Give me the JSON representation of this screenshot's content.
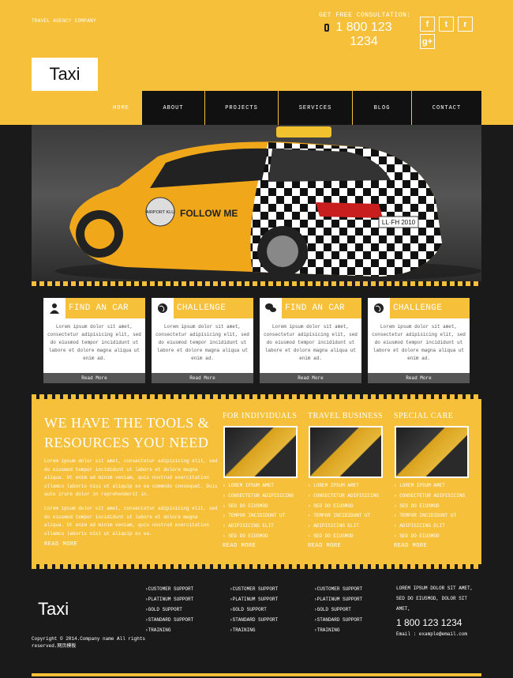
{
  "header": {
    "tagline": "TRAVEL AGENCY COMPANY",
    "consult_label": "GET FREE CONSULTATION:",
    "phone": "1 800 123 1234",
    "social": [
      {
        "icon": "facebook-icon",
        "glyph": "f"
      },
      {
        "icon": "twitter-icon",
        "glyph": "t"
      },
      {
        "icon": "rss-icon",
        "glyph": "r"
      },
      {
        "icon": "googleplus-icon",
        "glyph": "g+"
      }
    ]
  },
  "logo": "Taxi",
  "nav": [
    {
      "label": "HOME",
      "active": true
    },
    {
      "label": "ABOUT",
      "active": false
    },
    {
      "label": "PROJECTS",
      "active": false
    },
    {
      "label": "SERVICES",
      "active": false
    },
    {
      "label": "BLOG",
      "active": false
    },
    {
      "label": "CONTACT",
      "active": false
    }
  ],
  "hero": {
    "door_badge": "AIRPORT KLU",
    "door_text": "FOLLOW ME",
    "plate": "LL·FH 2010"
  },
  "cards": [
    {
      "title": "FIND AN CAR",
      "icon": "user-icon",
      "text": "Lorem ipsum dolor sit amet, consectetur adipisicing elit, sed do eiusmod tempor incididunt ut labore et dolore magna aliqua ut enim ad.",
      "button": "Read More"
    },
    {
      "title": "CHALLENGE",
      "icon": "globe-icon",
      "text": "Lorem ipsum dolor sit amet, consectetur adipisicing elit, sed do eiusmod tempor incididunt ut labore et dolore magna aliqua ut enim ad.",
      "button": "Read More"
    },
    {
      "title": "FIND AN CAR",
      "icon": "chat-icon",
      "text": "Lorem ipsum dolor sit amet, consectetur adipisicing elit, sed do eiusmod tempor incididunt ut labore et dolore magna aliqua ut enim ad.",
      "button": "Read More"
    },
    {
      "title": "CHALLENGE",
      "icon": "globe-icon",
      "text": "Lorem ipsum dolor sit amet, consectetur adipisicing elit, sed do eiusmod tempor incididunt ut labore et dolore magna aliqua ut enim ad.",
      "button": "Read More"
    }
  ],
  "mid": {
    "title": "WE HAVE THE TOOLS & RESOURCES YOU NEED",
    "para1": "Lorem ipsum dolor sit amet, consectetur adipisicing elit, sed do eiusmod tempor incididunt ut labore et dolore magna aliqua. Ut enim ad minim veniam, quis nostrud exercitation ullamco laboris nisi ut aliquip ex ea commodo consequat. Duis aute irure dolor in reprehenderit in.",
    "para2": "Lorem ipsum dolor sit amet, consectetur adipisicing elit, sed do eiusmod tempor incididunt ut labore et dolore magna aliqua. Ut enim ad minim veniam, quis nostrud exercitation ullamco laboris nisi ut aliquip ex ea.",
    "read_more": "READ MORE",
    "columns": [
      {
        "title": "FOR INDIVIDUALS",
        "items": [
          "LOREM IPSUM AMET",
          "CONSECTETUR ADIPISICING",
          "SED DO EIUSMOD",
          "TEMPOR INCIDIDUNT UT",
          "ADIPISICING ELIT",
          "SED DO EIUSMOD"
        ],
        "read_more": "READ MORE"
      },
      {
        "title": "TRAVEL BUSINESS",
        "items": [
          "LOREM IPSUM AMET",
          "CONSECTETUR ADIPISICING",
          "SED DO EIUSMOD",
          "TEMPOR INCIDIDUNT UT",
          "ADIPISICING ELIT",
          "SED DO EIUSMOD"
        ],
        "read_more": "READ MORE"
      },
      {
        "title": "SPECIAL CARE",
        "items": [
          "LOREM IPSUM AMET",
          "CONSECTETUR ADIPISICING",
          "SED DO EIUSMOD",
          "TEMPOR INCIDIDUNT UT",
          "ADIPISICING ELIT",
          "SED DO EIUSMOD"
        ],
        "read_more": "READ MORE"
      }
    ]
  },
  "footer": {
    "logo": "Taxi",
    "copyright": "Copyright © 2014.Company name All rights reserved.网页模板",
    "lists": [
      [
        "CUSTOMER SUPPORT",
        "PLATINUM SUPPORT",
        "GOLD SUPPORT",
        "STANDARD SUPPORT",
        "TRAINING"
      ],
      [
        "CUSTOMER SUPPORT",
        "PLATINUM SUPPORT",
        "GOLD SUPPORT",
        "STANDARD SUPPORT",
        "TRAINING"
      ],
      [
        "CUSTOMER SUPPORT",
        "PLATINUM SUPPORT",
        "GOLD SUPPORT",
        "STANDARD SUPPORT",
        "TRAINING"
      ]
    ],
    "address": "LOREM IPSUM DOLOR SIT AMET, SED DO EIUSMOD, DOLOR SIT AMET,",
    "phone": "1 800 123 1234",
    "email": "Email : example@email.com"
  },
  "colors": {
    "accent": "#f6c03a",
    "dark": "#1a1a1a"
  }
}
